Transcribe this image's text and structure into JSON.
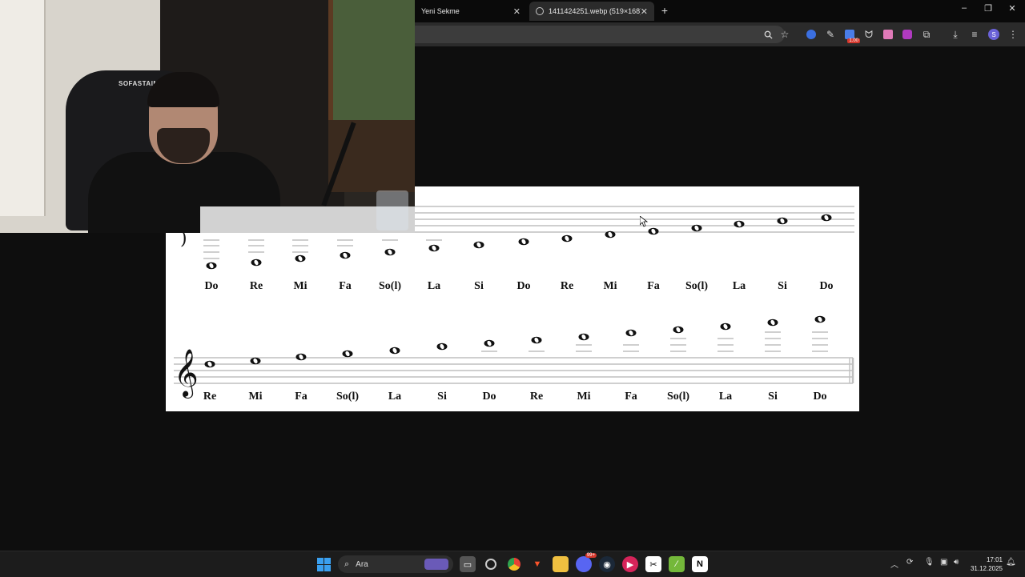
{
  "browser": {
    "tabs": [
      {
        "title": "Yeni Sekme",
        "active": false
      },
      {
        "title": "1411424251.webp (519×168)",
        "active": true
      }
    ],
    "new_tab_label": "+",
    "close_glyph": "✕",
    "toolbar_icons": [
      "zoom-icon",
      "star-icon",
      "extension-blue-icon",
      "eyedropper-icon",
      "extension-badge-icon",
      "extension-cat-icon",
      "extension-pink-icon",
      "extension-purple-icon",
      "puzzle-icon",
      "download-icon",
      "media-icon",
      "profile-avatar",
      "menu-icon"
    ],
    "extension_badge": "1.00",
    "profile_initial": "S",
    "window_controls": [
      "–",
      "❐",
      "✕"
    ]
  },
  "webcam": {
    "chair_text": "SOFASTAIN"
  },
  "sheet": {
    "row1_labels": [
      "Do",
      "Re",
      "Mi",
      "Fa",
      "So(l)",
      "La",
      "Si",
      "Do",
      "Re",
      "Mi",
      "Fa",
      "So(l)",
      "La",
      "Si",
      "Do"
    ],
    "row2_labels": [
      "Re",
      "Mi",
      "Fa",
      "So(l)",
      "La",
      "Si",
      "Do",
      "Re",
      "Mi",
      "Fa",
      "So(l)",
      "La",
      "Si",
      "Do"
    ],
    "clef": "𝄞"
  },
  "taskbar": {
    "search_label": "Ara",
    "apps": [
      "widgets-icon",
      "task-view-icon",
      "obs-icon",
      "chrome-icon",
      "brave-icon",
      "file-explorer-icon",
      "discord-icon",
      "steam-icon",
      "media-player-icon",
      "capcut-icon",
      "xodo-icon",
      "notion-icon"
    ],
    "discord_badge": "99+",
    "time": "17:01",
    "date": "31.12.2025"
  }
}
